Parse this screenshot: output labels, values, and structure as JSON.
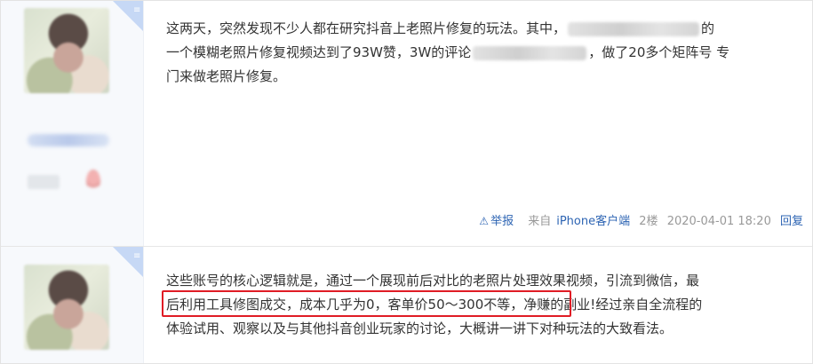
{
  "posts": [
    {
      "corner_glyph": "≡",
      "content": {
        "line1_a": "这两天，突然发现不少人都在研究抖音上老照片修复的玩法。其中，",
        "line1_b": "的",
        "line2_a": "一个模糊老照片修复视频达到了93W赞，3W的评论",
        "line2_b": "，做了20多个矩阵号 专",
        "line3": "门来做老照片修复。"
      },
      "meta": {
        "report_icon": "⚠",
        "report_label": "举报",
        "source_prefix": "来自",
        "source_client": "iPhone客户端",
        "floor": "2楼",
        "datetime": "2020-04-01 18:20",
        "reply_label": "回复"
      }
    },
    {
      "corner_glyph": "≡",
      "content": {
        "line1": "这些账号的核心逻辑就是，通过一个展现前后对比的老照片处理效果视频，引流到微信，最",
        "line2": "后利用工具修图成交，成本几乎为0，客单价50～300不等，净赚的副业!经过亲自全流程的",
        "line3": "体验试用、观察以及与其他抖音创业玩家的讨论，大概讲一讲下对种玩法的大致看法。"
      }
    }
  ],
  "colors": {
    "link": "#2d64b3",
    "meta_text": "#999999",
    "body_text": "#333333",
    "highlight_border": "#e01c25",
    "sidebar_bg": "#f7f9fc"
  }
}
